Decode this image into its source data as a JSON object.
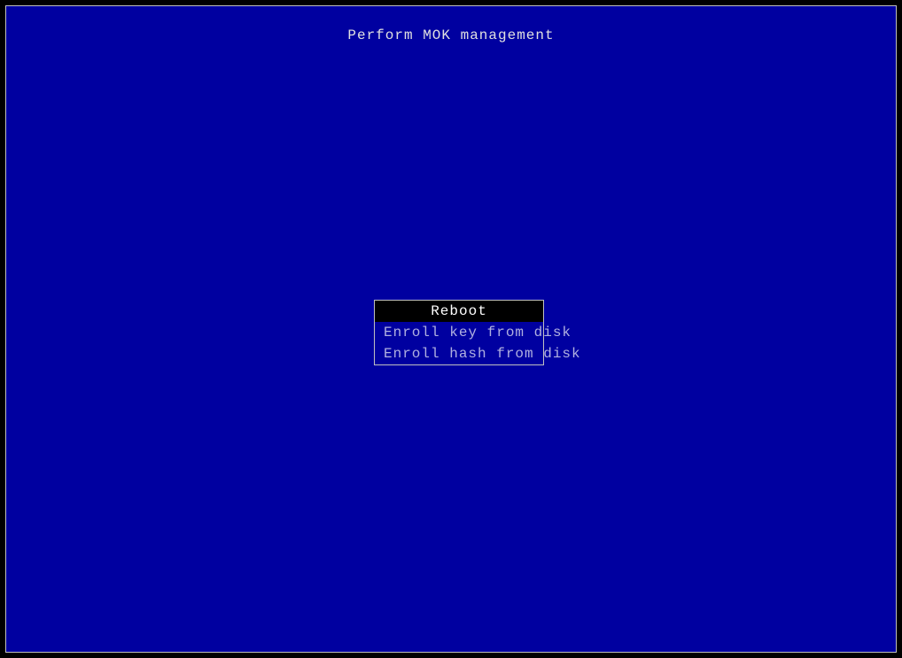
{
  "title": "Perform MOK management",
  "menu": {
    "items": [
      {
        "label": "Reboot",
        "selected": true
      },
      {
        "label": "Enroll key from disk",
        "selected": false
      },
      {
        "label": "Enroll hash from disk",
        "selected": false
      }
    ]
  }
}
